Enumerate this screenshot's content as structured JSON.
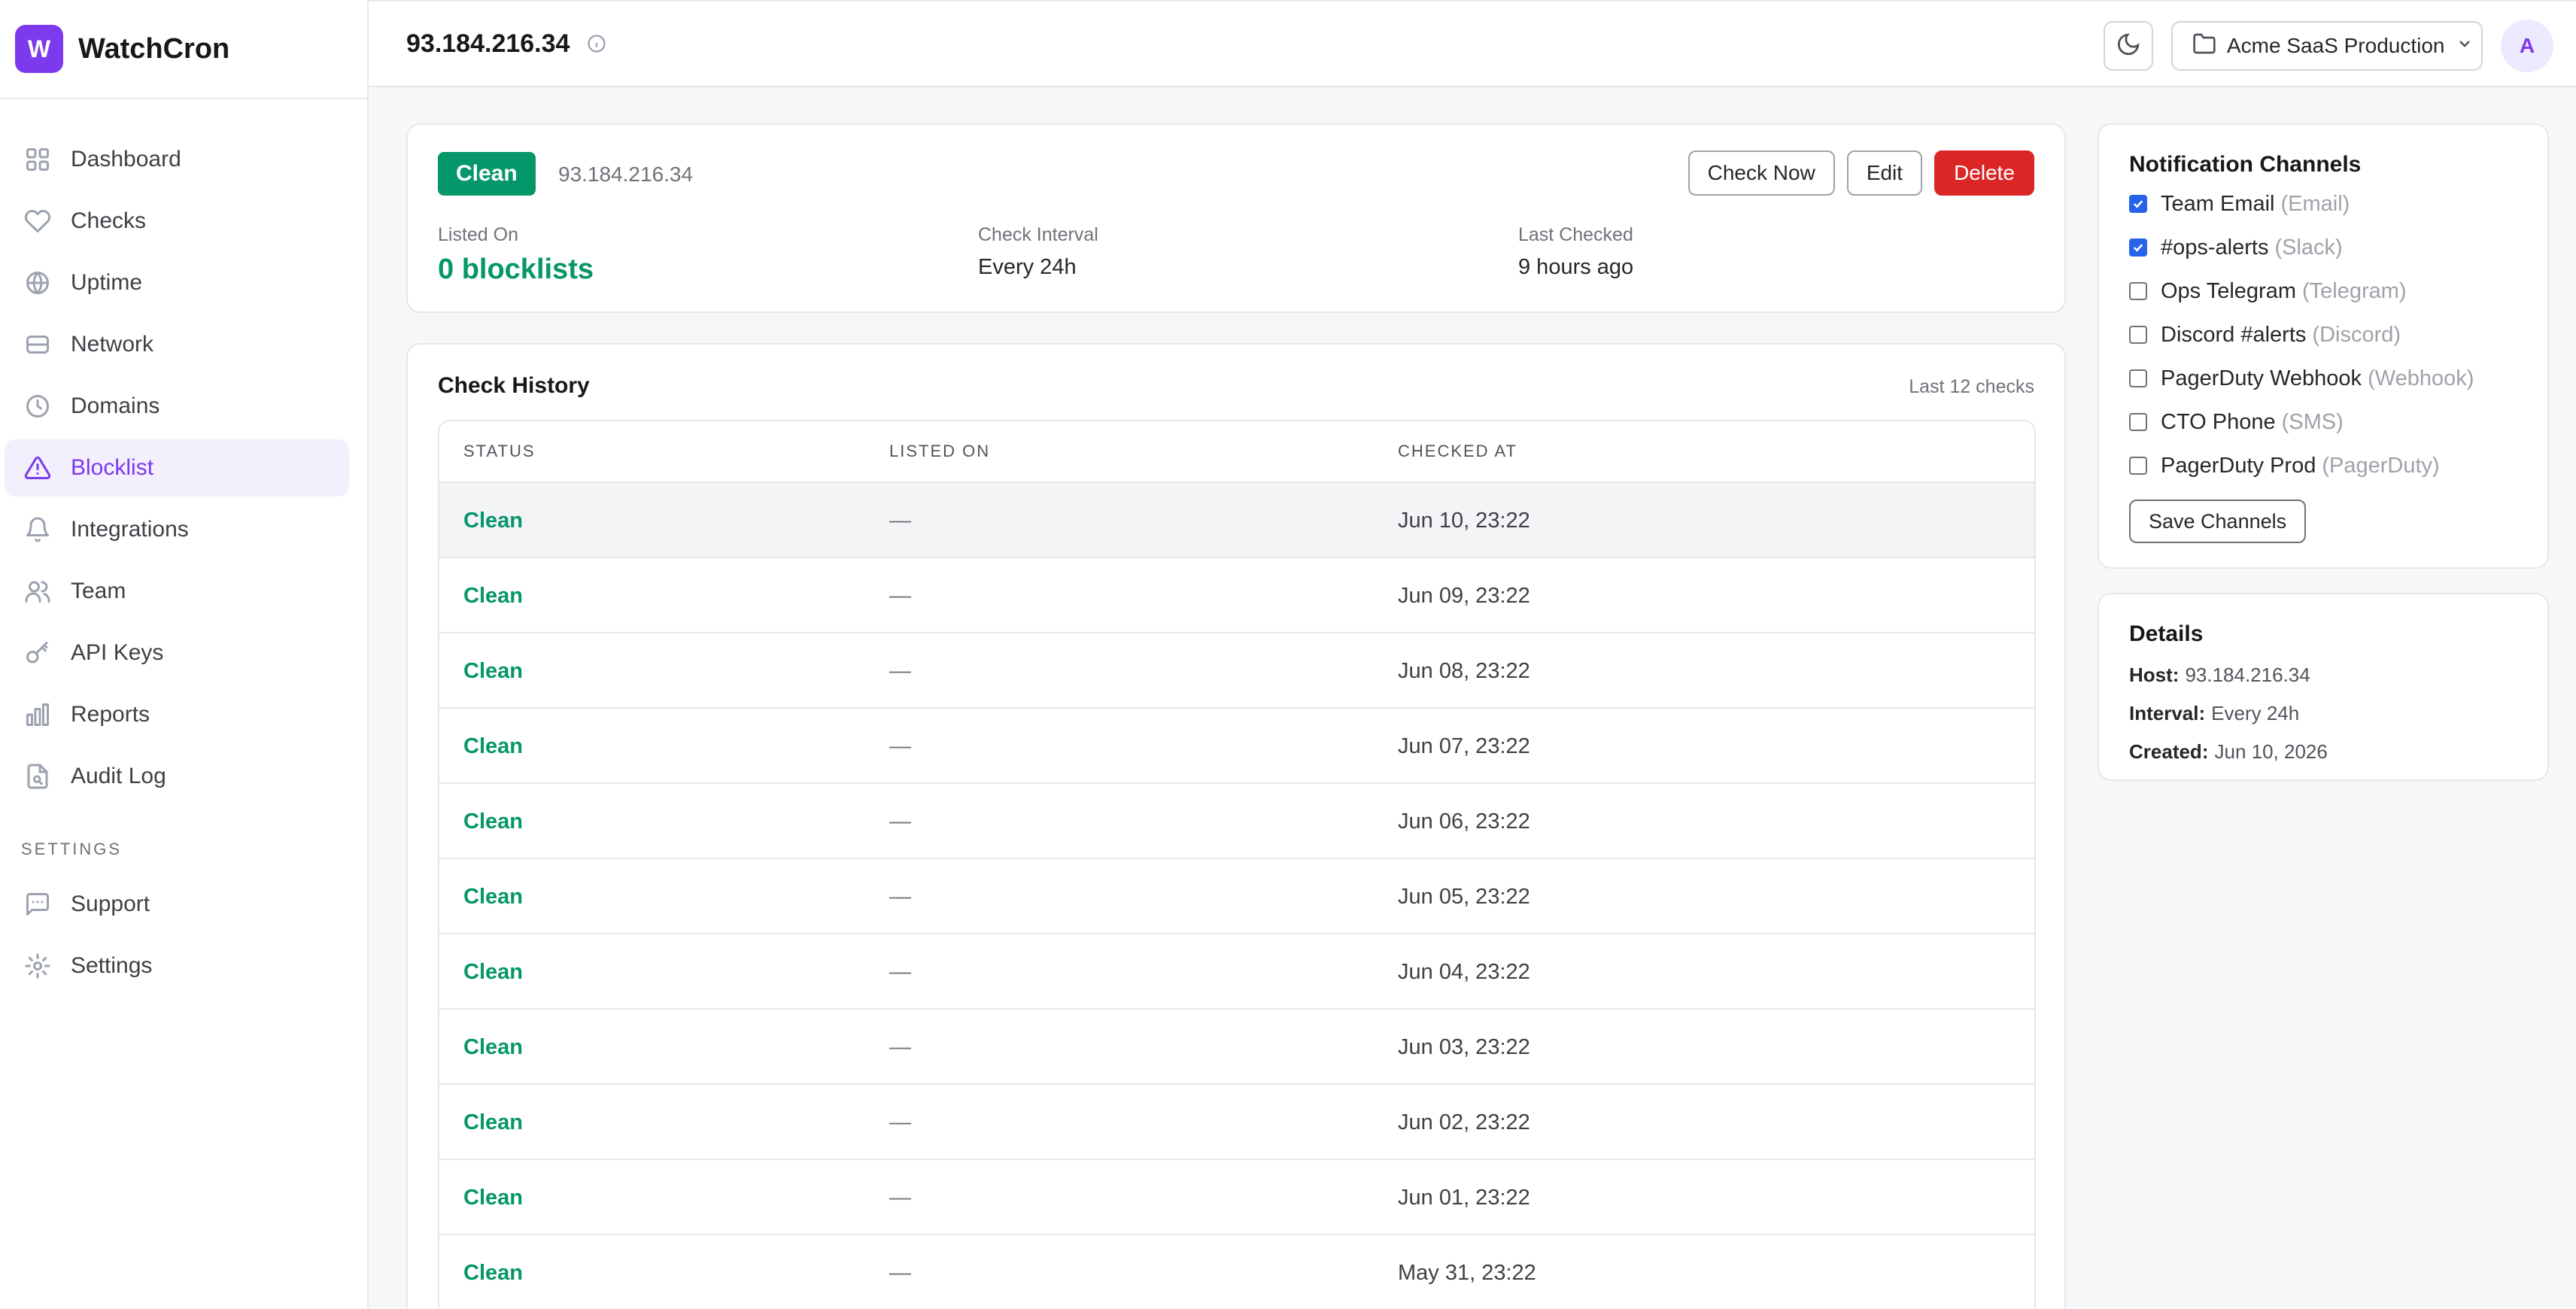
{
  "brand": {
    "initial": "W",
    "name": "WatchCron"
  },
  "nav": {
    "items": [
      {
        "label": "Dashboard",
        "icon": "grid-icon"
      },
      {
        "label": "Checks",
        "icon": "heart-icon"
      },
      {
        "label": "Uptime",
        "icon": "globe-icon"
      },
      {
        "label": "Network",
        "icon": "server-icon"
      },
      {
        "label": "Domains",
        "icon": "clock-icon"
      },
      {
        "label": "Blocklist",
        "icon": "warning-icon",
        "active": true
      },
      {
        "label": "Integrations",
        "icon": "bell-icon"
      },
      {
        "label": "Team",
        "icon": "users-icon"
      },
      {
        "label": "API Keys",
        "icon": "key-icon"
      },
      {
        "label": "Reports",
        "icon": "bar-chart-icon"
      },
      {
        "label": "Audit Log",
        "icon": "file-search-icon"
      }
    ],
    "settings_heading": "SETTINGS",
    "settings_items": [
      {
        "label": "Support",
        "icon": "message-icon"
      },
      {
        "label": "Settings",
        "icon": "gear-icon"
      }
    ]
  },
  "header": {
    "title": "93.184.216.34",
    "project": "Acme SaaS Production",
    "avatar": "A"
  },
  "summary": {
    "status": "Clean",
    "host": "93.184.216.34",
    "actions": {
      "check_now": "Check Now",
      "edit": "Edit",
      "delete": "Delete"
    },
    "listed_on_label": "Listed On",
    "listed_on_value": "0 blocklists",
    "interval_label": "Check Interval",
    "interval_value": "Every 24h",
    "last_checked_label": "Last Checked",
    "last_checked_value": "9 hours ago"
  },
  "history": {
    "title": "Check History",
    "count": "Last 12 checks",
    "columns": [
      "STATUS",
      "LISTED ON",
      "CHECKED AT"
    ],
    "rows": [
      {
        "status": "Clean",
        "listed": "—",
        "checked": "Jun 10, 23:22"
      },
      {
        "status": "Clean",
        "listed": "—",
        "checked": "Jun 09, 23:22"
      },
      {
        "status": "Clean",
        "listed": "—",
        "checked": "Jun 08, 23:22"
      },
      {
        "status": "Clean",
        "listed": "—",
        "checked": "Jun 07, 23:22"
      },
      {
        "status": "Clean",
        "listed": "—",
        "checked": "Jun 06, 23:22"
      },
      {
        "status": "Clean",
        "listed": "—",
        "checked": "Jun 05, 23:22"
      },
      {
        "status": "Clean",
        "listed": "—",
        "checked": "Jun 04, 23:22"
      },
      {
        "status": "Clean",
        "listed": "—",
        "checked": "Jun 03, 23:22"
      },
      {
        "status": "Clean",
        "listed": "—",
        "checked": "Jun 02, 23:22"
      },
      {
        "status": "Clean",
        "listed": "—",
        "checked": "Jun 01, 23:22"
      },
      {
        "status": "Clean",
        "listed": "—",
        "checked": "May 31, 23:22"
      }
    ]
  },
  "channels": {
    "title": "Notification Channels",
    "items": [
      {
        "name": "Team Email",
        "type": "(Email)",
        "checked": true
      },
      {
        "name": "#ops-alerts",
        "type": "(Slack)",
        "checked": true
      },
      {
        "name": "Ops Telegram",
        "type": "(Telegram)",
        "checked": false
      },
      {
        "name": "Discord #alerts",
        "type": "(Discord)",
        "checked": false
      },
      {
        "name": "PagerDuty Webhook",
        "type": "(Webhook)",
        "checked": false
      },
      {
        "name": "CTO Phone",
        "type": "(SMS)",
        "checked": false
      },
      {
        "name": "PagerDuty Prod",
        "type": "(PagerDuty)",
        "checked": false
      }
    ],
    "save_label": "Save Channels"
  },
  "details": {
    "title": "Details",
    "host_label": "Host:",
    "host_value": "93.184.216.34",
    "interval_label": "Interval:",
    "interval_value": "Every 24h",
    "created_label": "Created:",
    "created_value": "Jun 10, 2026"
  },
  "colors": {
    "accent": "#7c3aed",
    "success": "#059669",
    "danger": "#dc2626",
    "check": "#2563eb"
  }
}
